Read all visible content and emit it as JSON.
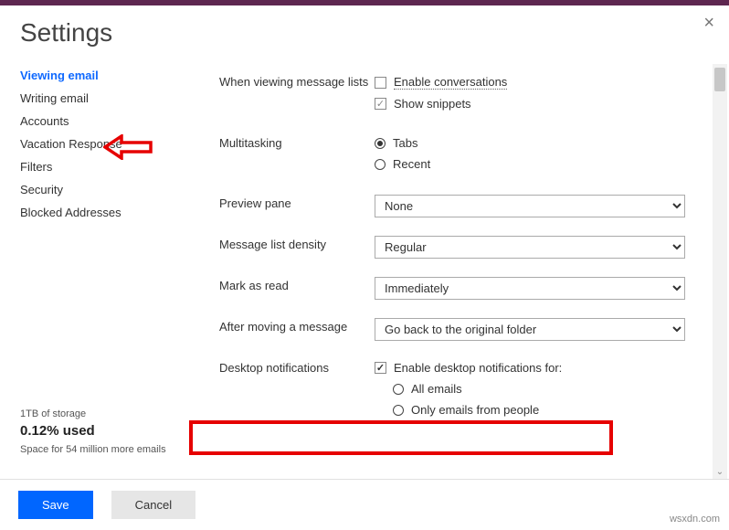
{
  "title": "Settings",
  "sidebar": {
    "items": [
      {
        "label": "Viewing email",
        "active": true
      },
      {
        "label": "Writing email"
      },
      {
        "label": "Accounts"
      },
      {
        "label": "Vacation Response"
      },
      {
        "label": "Filters"
      },
      {
        "label": "Security"
      },
      {
        "label": "Blocked Addresses"
      }
    ],
    "storage": {
      "total": "1TB of storage",
      "used_pct": "0.12% used",
      "hint": "Space for 54 million more emails"
    }
  },
  "rows": {
    "viewing_lists": "When viewing message lists",
    "multitasking": "Multitasking",
    "preview_pane": "Preview pane",
    "density": "Message list density",
    "mark_read": "Mark as read",
    "after_move": "After moving a message",
    "desktop_notif": "Desktop notifications"
  },
  "controls": {
    "enable_conv": "Enable conversations",
    "show_snippets": "Show snippets",
    "tabs": "Tabs",
    "recent": "Recent",
    "preview_value": "None",
    "density_value": "Regular",
    "mark_read_value": "Immediately",
    "after_move_value": "Go back to the original folder",
    "enable_desktop": "Enable desktop notifications for:",
    "all_emails": "All emails",
    "only_people": "Only emails from people"
  },
  "footer": {
    "save": "Save",
    "cancel": "Cancel"
  },
  "watermark": "wsxdn.com"
}
